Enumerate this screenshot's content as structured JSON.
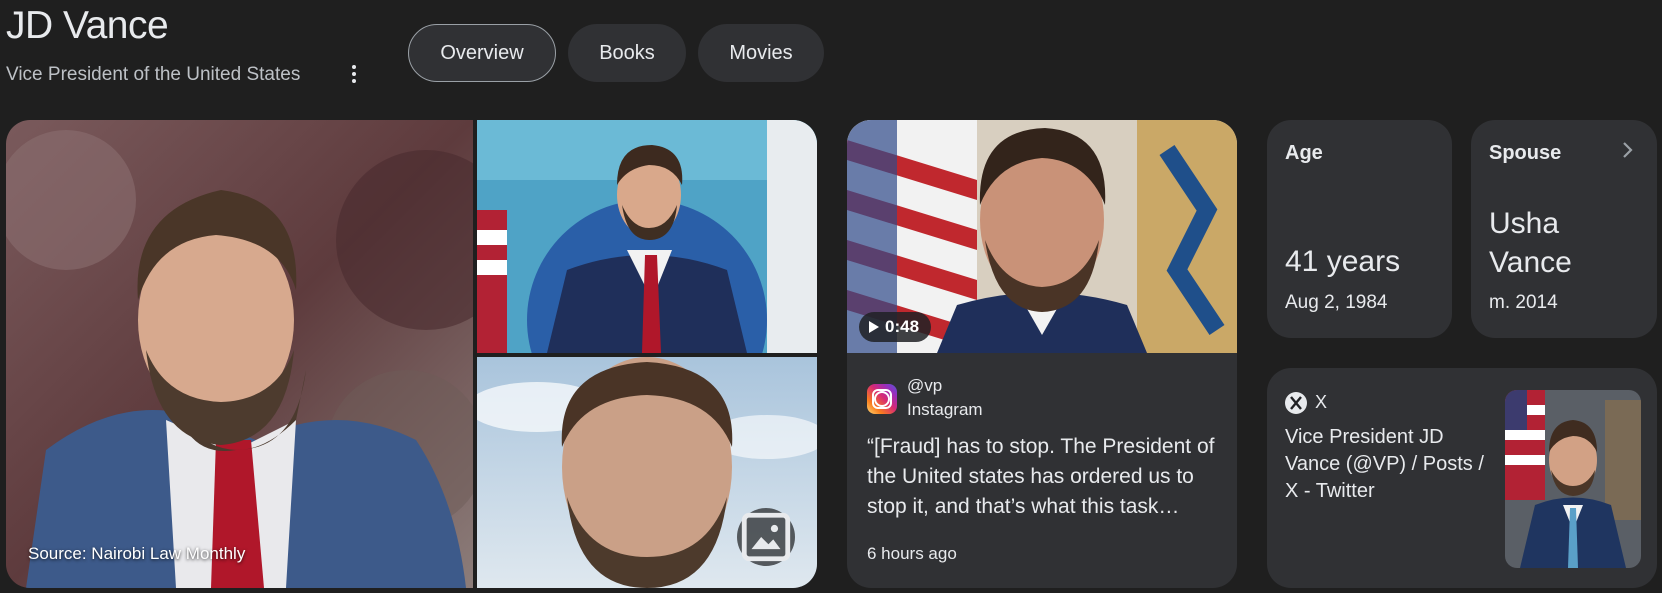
{
  "entity": {
    "name": "JD Vance",
    "description": "Vice President of the United States"
  },
  "icons": {
    "more": "more-vert-icon",
    "image": "image-icon",
    "play": "play-icon",
    "chevron": "chevron-right-icon",
    "instagram": "instagram-icon",
    "x": "x-logo-icon"
  },
  "tabs": [
    {
      "label": "Overview"
    },
    {
      "label": "Books"
    },
    {
      "label": "Movies"
    }
  ],
  "images": {
    "source_label": "Source: Nairobi Law Monthly"
  },
  "post": {
    "duration": "0:48",
    "handle": "@vp",
    "platform": "Instagram",
    "quote": "“[Fraud] has to stop. The President of the United states has ordered us to stop it, and that’s what this task…",
    "time": "6 hours ago"
  },
  "facts": {
    "age": {
      "label": "Age",
      "value": "41 years",
      "sub": "Aug 2, 1984"
    },
    "spouse": {
      "label": "Spouse",
      "value_line1": "Usha",
      "value_line2": "Vance",
      "sub": "m. 2014"
    }
  },
  "social": {
    "network": "X",
    "title": "Vice President JD Vance (@VP) / Posts / X - Twitter"
  },
  "colors": {
    "background": "#1f1f1f",
    "card": "#303134",
    "text": "#e8eaed",
    "muted": "#bdc1c6"
  }
}
